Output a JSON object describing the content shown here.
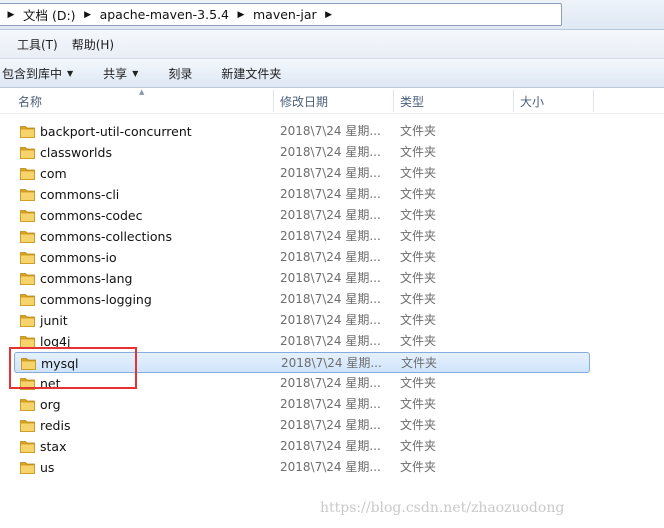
{
  "breadcrumb": [
    {
      "label": "文档 (D:)"
    },
    {
      "label": "apache-maven-3.5.4"
    },
    {
      "label": "maven-jar"
    }
  ],
  "menu": {
    "tools": "工具(T)",
    "help": "帮助(H)"
  },
  "commands": {
    "include_in_library": "包含到库中",
    "share": "共享",
    "burn": "刻录",
    "new_folder": "新建文件夹"
  },
  "columns": {
    "name": "名称",
    "date_modified": "修改日期",
    "type": "类型",
    "size": "大小"
  },
  "files": [
    {
      "name": "backport-util-concurrent",
      "date": "2018\\7\\24 星期...",
      "type": "文件夹"
    },
    {
      "name": "classworlds",
      "date": "2018\\7\\24 星期...",
      "type": "文件夹"
    },
    {
      "name": "com",
      "date": "2018\\7\\24 星期...",
      "type": "文件夹"
    },
    {
      "name": "commons-cli",
      "date": "2018\\7\\24 星期...",
      "type": "文件夹"
    },
    {
      "name": "commons-codec",
      "date": "2018\\7\\24 星期...",
      "type": "文件夹"
    },
    {
      "name": "commons-collections",
      "date": "2018\\7\\24 星期...",
      "type": "文件夹"
    },
    {
      "name": "commons-io",
      "date": "2018\\7\\24 星期...",
      "type": "文件夹"
    },
    {
      "name": "commons-lang",
      "date": "2018\\7\\24 星期...",
      "type": "文件夹"
    },
    {
      "name": "commons-logging",
      "date": "2018\\7\\24 星期...",
      "type": "文件夹"
    },
    {
      "name": "junit",
      "date": "2018\\7\\24 星期...",
      "type": "文件夹"
    },
    {
      "name": "log4j",
      "date": "2018\\7\\24 星期...",
      "type": "文件夹"
    },
    {
      "name": "mysql",
      "date": "2018\\7\\24 星期...",
      "type": "文件夹",
      "selected": true
    },
    {
      "name": "net",
      "date": "2018\\7\\24 星期...",
      "type": "文件夹"
    },
    {
      "name": "org",
      "date": "2018\\7\\24 星期...",
      "type": "文件夹"
    },
    {
      "name": "redis",
      "date": "2018\\7\\24 星期...",
      "type": "文件夹"
    },
    {
      "name": "stax",
      "date": "2018\\7\\24 星期...",
      "type": "文件夹"
    },
    {
      "name": "us",
      "date": "2018\\7\\24 星期...",
      "type": "文件夹"
    }
  ],
  "colors": {
    "selection_fill": "#cfe4fb",
    "selection_border": "#84acdd",
    "annotation_red": "#e53333",
    "folder_yellow": "#f2c94c"
  },
  "watermark": "https://blog.csdn.net/zhaozuodong"
}
